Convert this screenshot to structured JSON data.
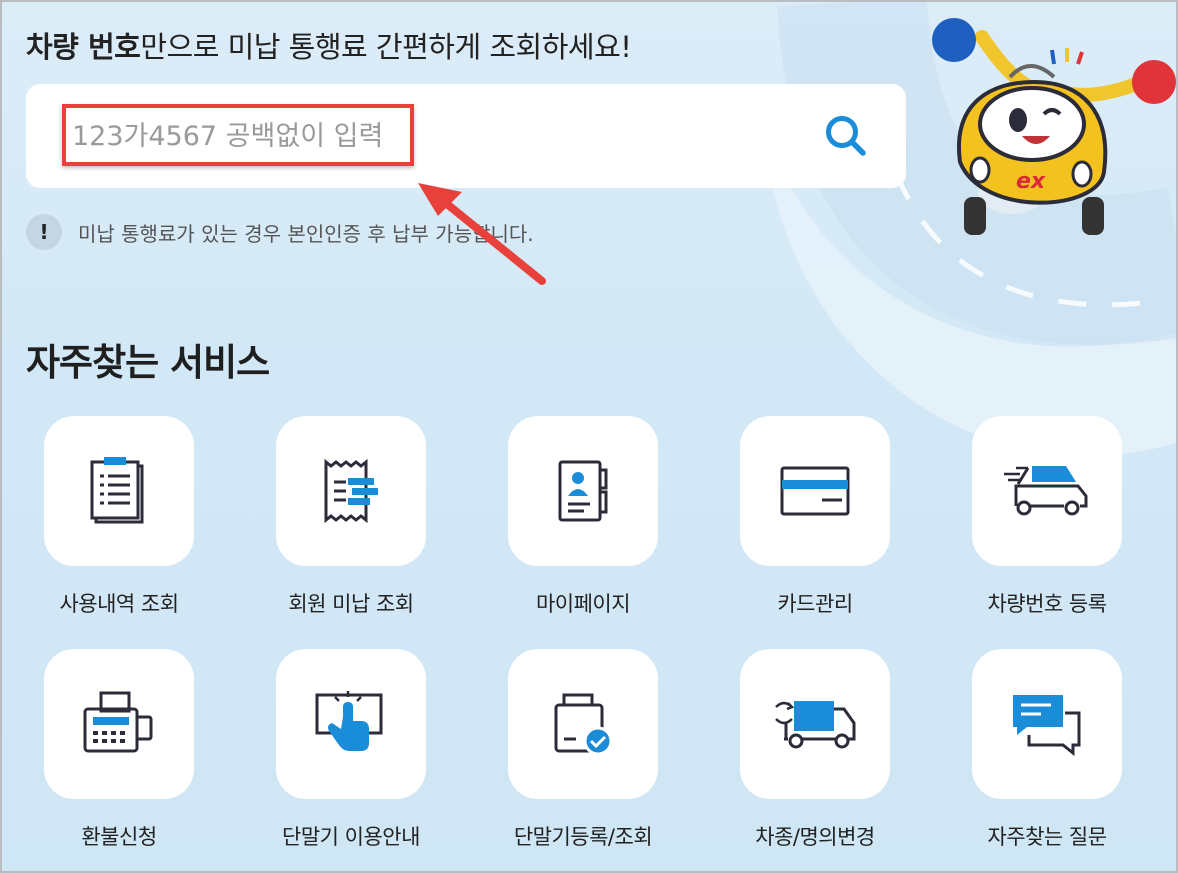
{
  "header": {
    "title_bold": "차량 번호",
    "title_rest": "만으로 미납 통행료 간편하게 조회하세요!"
  },
  "search": {
    "placeholder": "123가4567 공백없이 입력",
    "value": "",
    "button_icon": "search-icon"
  },
  "notice": {
    "icon": "!",
    "text": "미납 통행료가 있는 경우 본인인증 후 납부 가능합니다."
  },
  "section": {
    "title": "자주찾는 서비스"
  },
  "services": [
    {
      "label": "사용내역 조회",
      "icon": "clipboard-list-icon"
    },
    {
      "label": "회원 미납 조회",
      "icon": "receipt-icon"
    },
    {
      "label": "마이페이지",
      "icon": "profile-document-icon"
    },
    {
      "label": "카드관리",
      "icon": "credit-card-icon"
    },
    {
      "label": "차량번호 등록",
      "icon": "car-icon"
    },
    {
      "label": "환불신청",
      "icon": "fax-machine-icon"
    },
    {
      "label": "단말기 이용안내",
      "icon": "touch-screen-icon"
    },
    {
      "label": "단말기등록/조회",
      "icon": "device-check-icon"
    },
    {
      "label": "차종/명의변경",
      "icon": "truck-change-icon"
    },
    {
      "label": "자주찾는 질문",
      "icon": "chat-bubbles-icon"
    }
  ],
  "colors": {
    "accent": "#1a8cd8",
    "highlight": "#e8413c",
    "background": "#d6eaf7"
  },
  "mascot": {
    "badge_text": "ex"
  }
}
